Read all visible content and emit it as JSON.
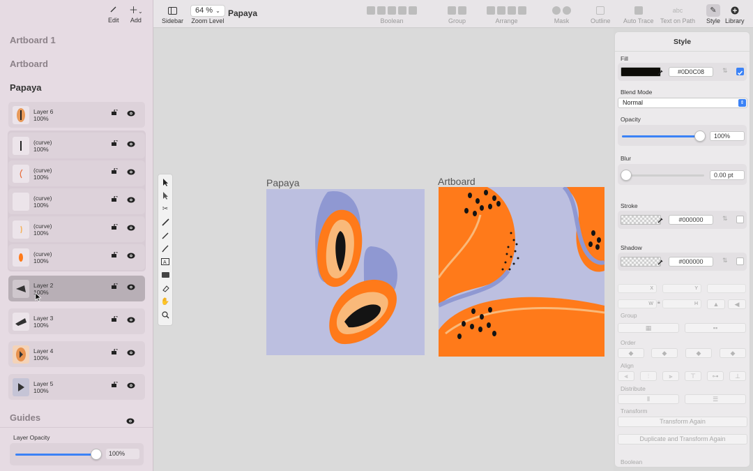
{
  "sidebar": {
    "edit_label": "Edit",
    "add_label": "Add",
    "artboards": [
      "Artboard 1",
      "Artboard",
      "Papaya"
    ],
    "layers": [
      {
        "name": "Layer 6",
        "opacity": "100%"
      },
      {
        "name": "(curve)",
        "opacity": "100%"
      },
      {
        "name": "(curve)",
        "opacity": "100%"
      },
      {
        "name": "(curve)",
        "opacity": "100%"
      },
      {
        "name": "(curve)",
        "opacity": "100%"
      },
      {
        "name": "(curve)",
        "opacity": "100%"
      },
      {
        "name": "Layer 2",
        "opacity": "100%"
      },
      {
        "name": "Layer 3",
        "opacity": "100%"
      },
      {
        "name": "Layer 4",
        "opacity": "100%"
      },
      {
        "name": "Layer 5",
        "opacity": "100%"
      }
    ],
    "guides_label": "Guides",
    "layer_opacity_label": "Layer Opacity",
    "layer_opacity_value": "100%"
  },
  "toolbar": {
    "sidebar_label": "Sidebar",
    "zoom_value": "64 %",
    "zoom_label": "Zoom Level",
    "doc_title": "Papaya",
    "boolean_label": "Boolean",
    "group_label": "Group",
    "arrange_label": "Arrange",
    "mask_label": "Mask",
    "outline_label": "Outline",
    "autotrace_label": "Auto Trace",
    "textpath_label": "Text on Path",
    "textpath_glyph": "abc",
    "style_label": "Style",
    "library_label": "Library"
  },
  "canvas": {
    "artboard_left_label": "Papaya",
    "artboard_right_label": "Artboard"
  },
  "inspector": {
    "title": "Style",
    "fill_label": "Fill",
    "fill_hex": "#0D0C08",
    "blend_label": "Blend Mode",
    "blend_value": "Normal",
    "opacity_label": "Opacity",
    "opacity_value": "100%",
    "blur_label": "Blur",
    "blur_value": "0.00 pt",
    "stroke_label": "Stroke",
    "stroke_hex": "#000000",
    "shadow_label": "Shadow",
    "shadow_hex": "#000000",
    "x_label": "X",
    "y_label": "Y",
    "w_label": "W",
    "h_label": "H",
    "group_label": "Group",
    "order_label": "Order",
    "align_label": "Align",
    "distribute_label": "Distribute",
    "transform_label": "Transform",
    "transform_again_label": "Transform Again",
    "duplicate_label": "Duplicate and Transform Again",
    "boolean_label": "Boolean"
  },
  "colors": {
    "accent": "#3b82f6",
    "papaya_orange": "#ff7a1a",
    "lavender": "#bcbfe0",
    "fill_swatch": "#0D0C08"
  }
}
